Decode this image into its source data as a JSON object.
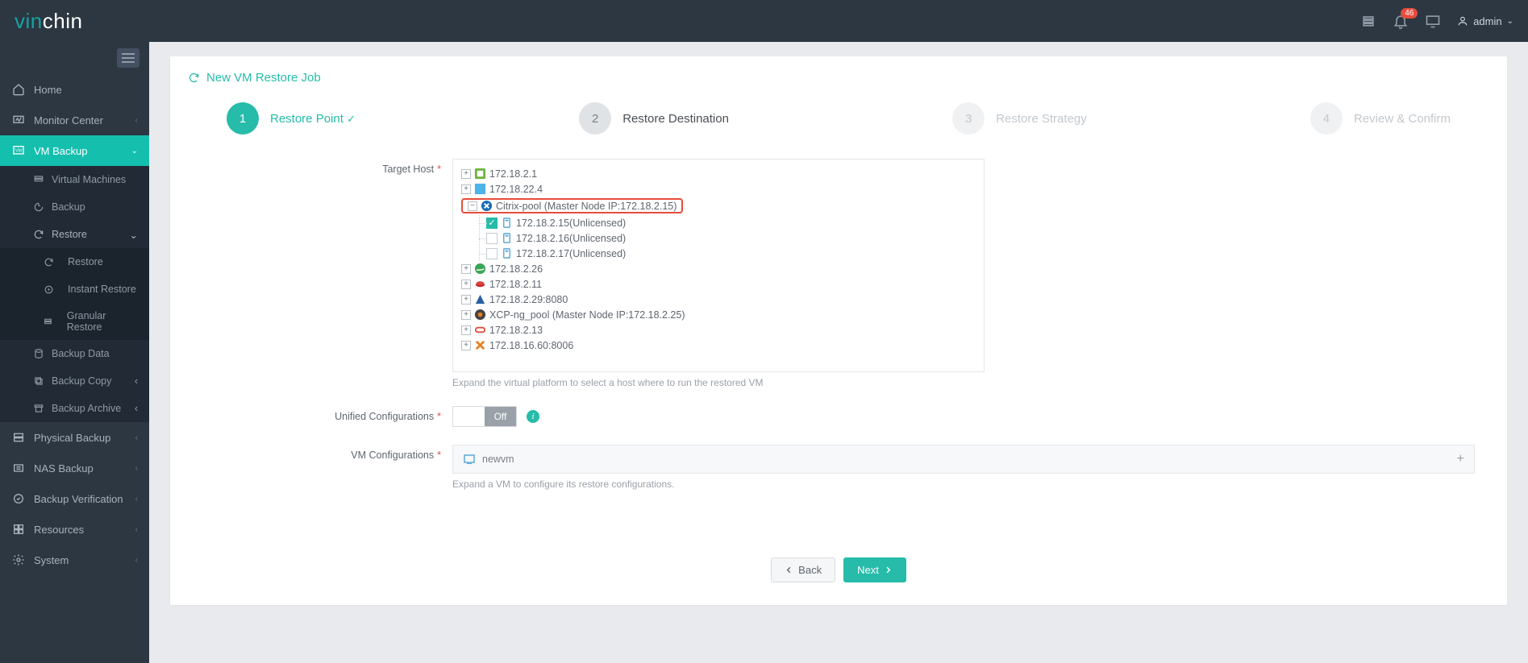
{
  "brand": {
    "prefix": "vin",
    "suffix": "chin"
  },
  "topbar": {
    "notification_count": "46",
    "user_label": "admin"
  },
  "sidebar": {
    "home": "Home",
    "monitor": "Monitor Center",
    "vm_backup": "VM Backup",
    "vm_sub": {
      "virtual_machines": "Virtual Machines",
      "backup": "Backup",
      "restore": "Restore",
      "restore_sub": {
        "restore": "Restore",
        "instant": "Instant Restore",
        "granular": "Granular Restore"
      },
      "backup_data": "Backup Data",
      "backup_copy": "Backup Copy",
      "backup_archive": "Backup Archive"
    },
    "physical": "Physical Backup",
    "nas": "NAS Backup",
    "verify": "Backup Verification",
    "resources": "Resources",
    "system": "System"
  },
  "page": {
    "title": "New VM Restore Job"
  },
  "wizard": {
    "s1": {
      "num": "1",
      "label": "Restore Point"
    },
    "s2": {
      "num": "2",
      "label": "Restore Destination"
    },
    "s3": {
      "num": "3",
      "label": "Restore Strategy"
    },
    "s4": {
      "num": "4",
      "label": "Review & Confirm"
    }
  },
  "form": {
    "target_host_label": "Target Host",
    "hosts": {
      "h1": "172.18.2.1",
      "h2": "172.18.22.4",
      "citrix": "Citrix-pool (Master Node IP:172.18.2.15)",
      "citrix_children": {
        "c1": "172.18.2.15(Unlicensed)",
        "c2": "172.18.2.16(Unlicensed)",
        "c3": "172.18.2.17(Unlicensed)"
      },
      "h4": "172.18.2.26",
      "h5": "172.18.2.11",
      "h6": "172.18.2.29:8080",
      "h7": "XCP-ng_pool (Master Node IP:172.18.2.25)",
      "h8": "172.18.2.13",
      "h9": "172.18.16.60:8006"
    },
    "target_help": "Expand the virtual platform to select a host where to run the restored VM",
    "unified_label": "Unified Configurations",
    "toggle_off": "Off",
    "vm_config_label": "VM Configurations",
    "vm_name": "newvm",
    "vm_help": "Expand a VM to configure its restore configurations."
  },
  "buttons": {
    "back": "Back",
    "next": "Next"
  }
}
